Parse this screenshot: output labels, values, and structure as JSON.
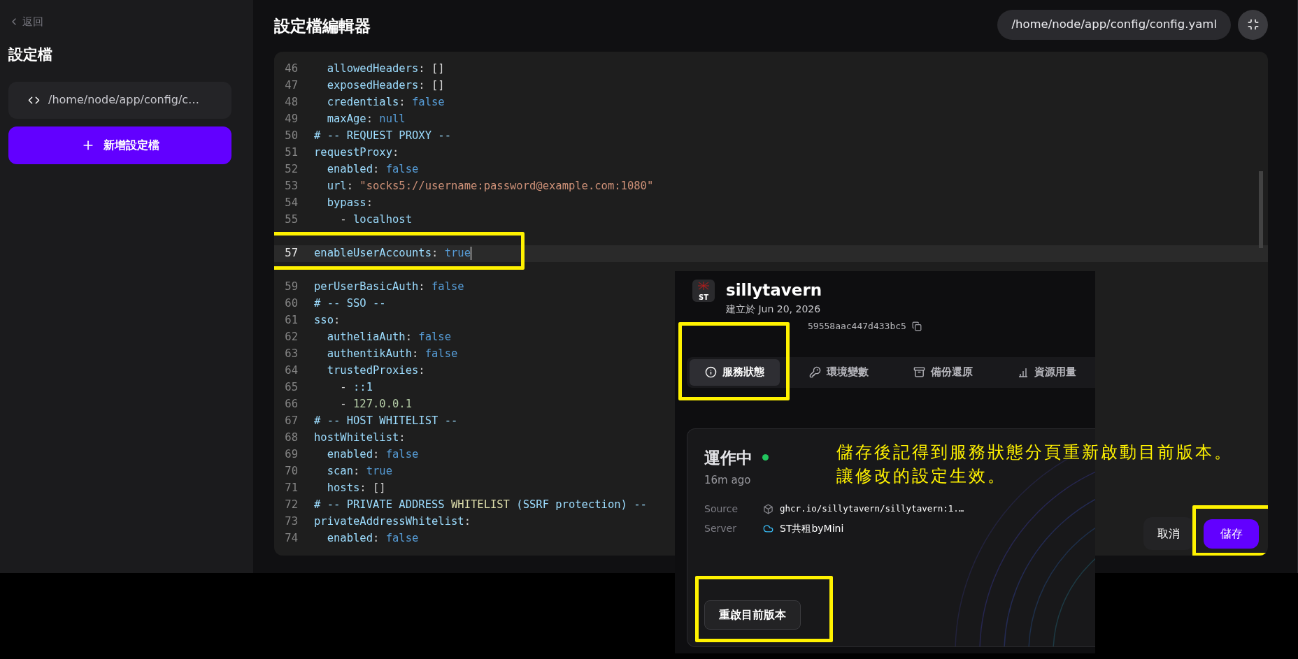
{
  "sidebar": {
    "back_link": "返回",
    "title": "設定檔",
    "files": [
      {
        "label": "/home/node/app/config/c…",
        "selected": true
      }
    ],
    "add_button": "新增設定檔"
  },
  "editor": {
    "title": "設定檔編輯器",
    "file_path": "/home/node/app/config/config.yaml",
    "lines": [
      {
        "number": "46",
        "active": false,
        "highlighted": false,
        "tokens": [
          {
            "kind": "key",
            "text": "  allowedHeaders"
          },
          {
            "kind": "plain",
            "text": ": []"
          }
        ]
      },
      {
        "number": "47",
        "active": false,
        "highlighted": false,
        "tokens": [
          {
            "kind": "key",
            "text": "  exposedHeaders"
          },
          {
            "kind": "plain",
            "text": ": []"
          }
        ]
      },
      {
        "number": "48",
        "active": false,
        "highlighted": false,
        "tokens": [
          {
            "kind": "key",
            "text": "  credentials"
          },
          {
            "kind": "plain",
            "text": ": "
          },
          {
            "kind": "bool",
            "text": "false"
          }
        ]
      },
      {
        "number": "49",
        "active": false,
        "highlighted": false,
        "tokens": [
          {
            "kind": "key",
            "text": "  maxAge"
          },
          {
            "kind": "plain",
            "text": ": "
          },
          {
            "kind": "bool",
            "text": "null"
          }
        ]
      },
      {
        "number": "50",
        "active": false,
        "highlighted": false,
        "tokens": [
          {
            "kind": "key",
            "text": "# -- REQUEST PROXY --"
          }
        ]
      },
      {
        "number": "51",
        "active": false,
        "highlighted": false,
        "tokens": [
          {
            "kind": "key",
            "text": "requestProxy"
          },
          {
            "kind": "plain",
            "text": ":"
          }
        ]
      },
      {
        "number": "52",
        "active": false,
        "highlighted": false,
        "tokens": [
          {
            "kind": "key",
            "text": "  enabled"
          },
          {
            "kind": "plain",
            "text": ": "
          },
          {
            "kind": "bool",
            "text": "false"
          }
        ]
      },
      {
        "number": "53",
        "active": false,
        "highlighted": false,
        "tokens": [
          {
            "kind": "key",
            "text": "  url"
          },
          {
            "kind": "plain",
            "text": ": "
          },
          {
            "kind": "string",
            "text": "\"socks5://username:password@example.com:1080\""
          }
        ]
      },
      {
        "number": "54",
        "active": false,
        "highlighted": false,
        "tokens": [
          {
            "kind": "key",
            "text": "  bypass"
          },
          {
            "kind": "plain",
            "text": ":"
          }
        ]
      },
      {
        "number": "55",
        "active": false,
        "highlighted": false,
        "tokens": [
          {
            "kind": "plain",
            "text": "    - "
          },
          {
            "kind": "key",
            "text": "localhost"
          }
        ]
      },
      {
        "kind": "covered"
      },
      {
        "number": "57",
        "active": true,
        "highlighted": true,
        "tokens": [
          {
            "kind": "key",
            "text": "enableUserAccounts"
          },
          {
            "kind": "plain",
            "text": ": "
          },
          {
            "kind": "bool",
            "text": "true"
          }
        ]
      },
      {
        "kind": "covered"
      },
      {
        "number": "59",
        "active": false,
        "highlighted": false,
        "tokens": [
          {
            "kind": "key",
            "text": "perUserBasicAuth"
          },
          {
            "kind": "plain",
            "text": ": "
          },
          {
            "kind": "bool",
            "text": "false"
          }
        ]
      },
      {
        "number": "60",
        "active": false,
        "highlighted": false,
        "tokens": [
          {
            "kind": "key",
            "text": "# -- SSO --"
          }
        ]
      },
      {
        "number": "61",
        "active": false,
        "highlighted": false,
        "tokens": [
          {
            "kind": "key",
            "text": "sso"
          },
          {
            "kind": "plain",
            "text": ":"
          }
        ]
      },
      {
        "number": "62",
        "active": false,
        "highlighted": false,
        "tokens": [
          {
            "kind": "key",
            "text": "  autheliaAuth"
          },
          {
            "kind": "plain",
            "text": ": "
          },
          {
            "kind": "bool",
            "text": "false"
          }
        ]
      },
      {
        "number": "63",
        "active": false,
        "highlighted": false,
        "tokens": [
          {
            "kind": "key",
            "text": "  authentikAuth"
          },
          {
            "kind": "plain",
            "text": ": "
          },
          {
            "kind": "bool",
            "text": "false"
          }
        ]
      },
      {
        "number": "64",
        "active": false,
        "highlighted": false,
        "tokens": [
          {
            "kind": "key",
            "text": "  trustedProxies"
          },
          {
            "kind": "plain",
            "text": ":"
          }
        ]
      },
      {
        "number": "65",
        "active": false,
        "highlighted": false,
        "tokens": [
          {
            "kind": "plain",
            "text": "    - "
          },
          {
            "kind": "key",
            "text": "::1"
          }
        ]
      },
      {
        "number": "66",
        "active": false,
        "highlighted": false,
        "tokens": [
          {
            "kind": "plain",
            "text": "    - "
          },
          {
            "kind": "number",
            "text": "127.0.0.1"
          }
        ]
      },
      {
        "number": "67",
        "active": false,
        "highlighted": false,
        "tokens": [
          {
            "kind": "key",
            "text": "# -- HOST WHITELIST --"
          }
        ]
      },
      {
        "number": "68",
        "active": false,
        "highlighted": false,
        "tokens": [
          {
            "kind": "key",
            "text": "hostWhitelist"
          },
          {
            "kind": "plain",
            "text": ":"
          }
        ]
      },
      {
        "number": "69",
        "active": false,
        "highlighted": false,
        "tokens": [
          {
            "kind": "key",
            "text": "  enabled"
          },
          {
            "kind": "plain",
            "text": ": "
          },
          {
            "kind": "bool",
            "text": "false"
          }
        ]
      },
      {
        "number": "70",
        "active": false,
        "highlighted": false,
        "tokens": [
          {
            "kind": "key",
            "text": "  scan"
          },
          {
            "kind": "plain",
            "text": ": "
          },
          {
            "kind": "bool",
            "text": "true"
          }
        ]
      },
      {
        "number": "71",
        "active": false,
        "highlighted": false,
        "tokens": [
          {
            "kind": "key",
            "text": "  hosts"
          },
          {
            "kind": "plain",
            "text": ": []"
          }
        ]
      },
      {
        "number": "72",
        "active": false,
        "highlighted": false,
        "tokens": [
          {
            "kind": "key",
            "text": "# -- PRIVATE ADDRESS "
          },
          {
            "kind": "func",
            "text": "WHITELIST"
          },
          {
            "kind": "key",
            "text": " (SSRF protection) --"
          }
        ]
      },
      {
        "number": "73",
        "active": false,
        "highlighted": false,
        "tokens": [
          {
            "kind": "key",
            "text": "privateAddressWhitelist"
          },
          {
            "kind": "plain",
            "text": ":"
          }
        ]
      },
      {
        "number": "74",
        "active": false,
        "highlighted": false,
        "tokens": [
          {
            "kind": "key",
            "text": "  enabled"
          },
          {
            "kind": "plain",
            "text": ": "
          },
          {
            "kind": "bool",
            "text": "false"
          }
        ]
      }
    ],
    "cancel_button": {
      "label": "取消"
    },
    "save_button": {
      "label": "儲存",
      "highlighted": true
    }
  },
  "service_panel": {
    "logo_text": "ST",
    "name": "sillytavern",
    "created": "建立於 Jun 20, 2026",
    "service_id": "59558aac447d433bc5",
    "tabs": [
      {
        "label": "服務狀態",
        "selected": true,
        "highlighted": true
      },
      {
        "label": "環境變數",
        "selected": false,
        "highlighted": false
      },
      {
        "label": "備份還原",
        "selected": false,
        "highlighted": false
      },
      {
        "label": "資源用量",
        "selected": false,
        "highlighted": false
      }
    ],
    "status": {
      "label": "運作中",
      "color": "#22c55e",
      "time": "16m ago",
      "fields": [
        {
          "label": "Source",
          "value": "ghcr.io/sillytavern/sillytavern:1.…",
          "kind": "mono"
        },
        {
          "label": "Server",
          "value": "ST共租byMini",
          "kind": "plain"
        }
      ]
    },
    "restart_button": {
      "label": "重啟目前版本",
      "highlighted": true
    }
  },
  "annotation": {
    "lines": [
      "儲存後記得到服務狀態分頁重新啟動目前版本。",
      "讓修改的設定生效。"
    ]
  }
}
